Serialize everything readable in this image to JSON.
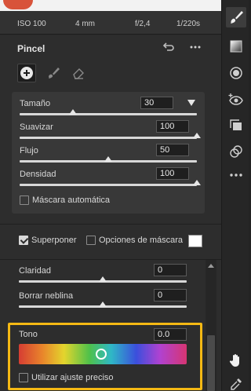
{
  "exif": {
    "iso": "ISO 100",
    "focal": "4 mm",
    "aperture": "f/2,4",
    "shutter": "1/220s"
  },
  "panel": {
    "title": "Pincel"
  },
  "brush": {
    "sliders": [
      {
        "label": "Tamaño",
        "value": "30",
        "fraction": 0.3
      },
      {
        "label": "Suavizar",
        "value": "100",
        "fraction": 1.0
      },
      {
        "label": "Flujo",
        "value": "50",
        "fraction": 0.5
      },
      {
        "label": "Densidad",
        "value": "100",
        "fraction": 1.0
      }
    ],
    "auto_mask_label": "Máscara automática",
    "auto_mask_checked": false
  },
  "overlay": {
    "label": "Superponer",
    "checked": true,
    "mask_options_label": "Opciones de máscara"
  },
  "adjust": {
    "sliders": [
      {
        "label": "Claridad",
        "value": "0",
        "fraction": 0.5
      },
      {
        "label": "Borrar neblina",
        "value": "0",
        "fraction": 0.5
      }
    ]
  },
  "tone": {
    "label": "Tono",
    "value": "0.0",
    "fraction": 0.5,
    "fine_label": "Utilizar ajuste preciso",
    "fine_checked": false
  },
  "colors": {
    "highlight": "#f5b914",
    "accent": "#d8d8d8"
  }
}
